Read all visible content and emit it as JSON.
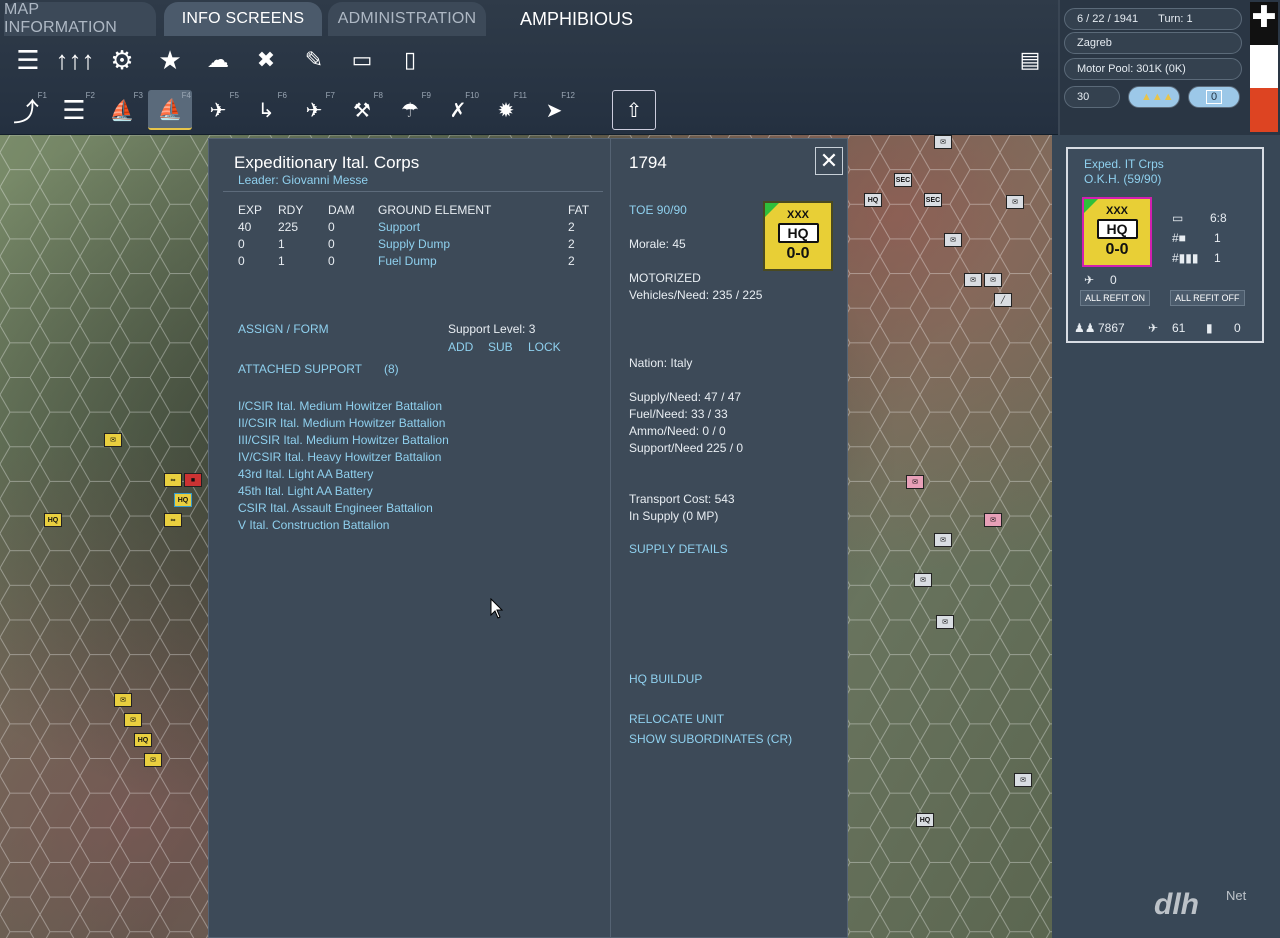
{
  "tabs": [
    "MAP INFORMATION",
    "INFO SCREENS",
    "ADMINISTRATION"
  ],
  "active_tab": "INFO SCREENS",
  "mode_title": "AMPHIBIOUS",
  "toolbar_row1_icons": [
    "naval-unit-icon",
    "ground-units-icon",
    "gear-icon",
    "star-icon",
    "weather-map-icon",
    "air-mission-icon",
    "satellite-icon",
    "card-icon",
    "tablet-icon"
  ],
  "toolbar_row2": [
    {
      "icon": "move-arrow-icon",
      "key": "F1"
    },
    {
      "icon": "rail-icon",
      "key": "F2"
    },
    {
      "icon": "ship-icon",
      "key": "F3"
    },
    {
      "icon": "amphibious-icon",
      "key": "F4"
    },
    {
      "icon": "air-transport-icon",
      "key": "F5"
    },
    {
      "icon": "para-drop-icon",
      "key": "F6"
    },
    {
      "icon": "airbase-icon",
      "key": "F7"
    },
    {
      "icon": "bomb-factory-icon",
      "key": "F8"
    },
    {
      "icon": "parachute-icon",
      "key": "F9"
    },
    {
      "icon": "fighter-intercept-icon",
      "key": "F10"
    },
    {
      "icon": "explosion-icon",
      "key": "F11"
    },
    {
      "icon": "next-unit-icon",
      "key": "F12"
    }
  ],
  "status": {
    "date": "6 / 22 / 1941",
    "turn": "Turn: 1",
    "location": "Zagreb",
    "motor_pool": "Motor Pool:  301K (0K)",
    "counter_30": "30",
    "counter_0": "0"
  },
  "info": {
    "unit_name": "Expeditionary Ital. Corps",
    "leader": "Leader: Giovanni Messe",
    "headers": [
      "EXP",
      "RDY",
      "DAM",
      "GROUND ELEMENT",
      "FAT"
    ],
    "elements": [
      {
        "exp": "40",
        "rdy": "225",
        "dam": "0",
        "name": "Support",
        "fat": "2"
      },
      {
        "exp": "0",
        "rdy": "1",
        "dam": "0",
        "name": "Supply Dump",
        "fat": "2"
      },
      {
        "exp": "0",
        "rdy": "1",
        "dam": "0",
        "name": "Fuel Dump",
        "fat": "2"
      }
    ],
    "assign_form": "ASSIGN / FORM",
    "support_level": "Support Level:  3",
    "add": "ADD",
    "sub": "SUB",
    "lock": "LOCK",
    "attached_support": "ATTACHED SUPPORT",
    "attached_count": "(8)",
    "attached_units": [
      "I/CSIR Ital. Medium Howitzer Battalion",
      "II/CSIR Ital. Medium Howitzer Battalion",
      "III/CSIR Ital. Medium Howitzer Battalion",
      "IV/CSIR Ital. Heavy Howitzer Battalion",
      "43rd Ital. Light AA Battery",
      "45th Ital. Light AA Battery",
      "CSIR Ital. Assault Engineer Battalion",
      "V Ital. Construction Battalion"
    ]
  },
  "details": {
    "id": "1794",
    "toe": "TOE 90/90",
    "morale": "Morale:    45",
    "motorized": "MOTORIZED",
    "vehicles": "Vehicles/Need:   235 / 225",
    "nation": "Nation:   Italy",
    "supply": "Supply/Need:    47 / 47",
    "fuel": "Fuel/Need:        33 / 33",
    "ammo": "Ammo/Need:    0 / 0",
    "support": "Support/Need    225 / 0",
    "transport_cost": "Transport Cost:       543",
    "in_supply": "In Supply (0 MP)",
    "supply_details": "SUPPLY DETAILS",
    "hq_buildup": "HQ BUILDUP",
    "relocate": "RELOCATE UNIT",
    "show_subs": "SHOW SUBORDINATES (CR)",
    "counter_size": "XXX",
    "counter_type": "HQ",
    "counter_strength": "0-0"
  },
  "unit_card": {
    "name": "Exped. IT Crps",
    "parent": "O.K.H.  (59/90)",
    "counter_size": "XXX",
    "counter_type": "HQ",
    "counter_strength": "0-0",
    "tanks_ratio": "6:8",
    "guns": "1",
    "aa": "1",
    "airfield": "0",
    "refit_on": "ALL REFIT ON",
    "refit_off": "ALL REFIT OFF",
    "men": "7867",
    "planes": "61",
    "afv": "0"
  },
  "map_counters": [
    {
      "label": "HQ",
      "color": "yellow"
    },
    {
      "label": "HQ",
      "color": "yellow"
    },
    {
      "label": "HQ",
      "color": "white"
    },
    {
      "label": "HQ",
      "color": "white"
    },
    {
      "label": "SEC",
      "color": "white"
    },
    {
      "label": "SEC",
      "color": "white"
    }
  ],
  "logo": {
    "text": "dlh",
    "net": "Net"
  }
}
